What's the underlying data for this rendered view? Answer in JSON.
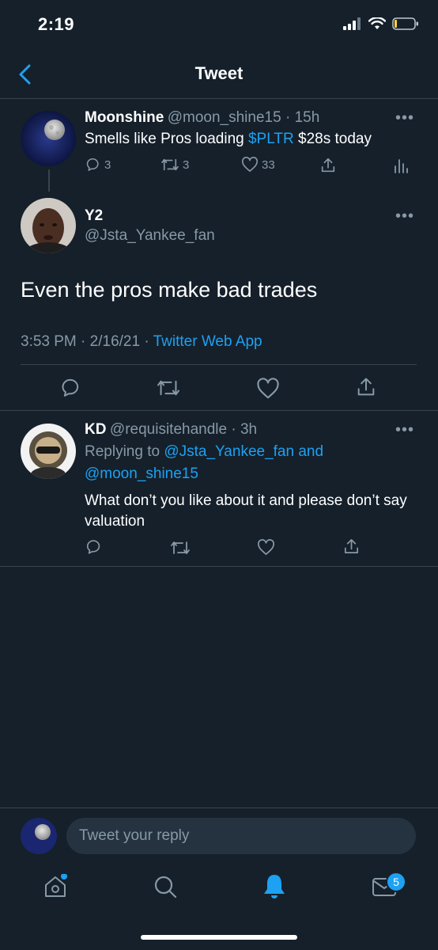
{
  "status_bar": {
    "time": "2:19"
  },
  "header": {
    "title": "Tweet"
  },
  "parent_tweet": {
    "name": "Moonshine",
    "handle": "@moon_shine15",
    "age": "15h",
    "text_before": "Smells like Pros loading ",
    "cashtag": "$PLTR",
    "text_after": " $28s today",
    "reply_count": "3",
    "retweet_count": "3",
    "like_count": "33"
  },
  "main_tweet": {
    "name": "Y2",
    "handle": "@Jsta_Yankee_fan",
    "text": "Even the pros make bad trades",
    "time": "3:53 PM",
    "date": "2/16/21",
    "source": "Twitter Web App"
  },
  "reply": {
    "name": "KD",
    "handle": "@requisitehandle",
    "age": "3h",
    "replying_prefix": "Replying to ",
    "replying_user1": "@Jsta_Yankee_fan",
    "replying_and": " and",
    "replying_user2": "@moon_shine15",
    "text": "What don’t you like about it and please don’t say valuation"
  },
  "compose": {
    "placeholder": "Tweet your reply"
  },
  "tab_bar": {
    "messages_badge": "5"
  },
  "colors": {
    "background": "#15202b",
    "accent": "#1da1f2",
    "muted": "#8899a6",
    "divider": "#38444d"
  }
}
